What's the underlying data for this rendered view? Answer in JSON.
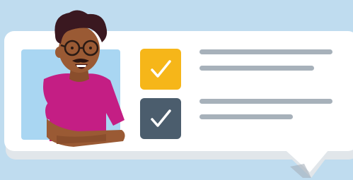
{
  "colors": {
    "background": "#bfdcef",
    "bubble": "#ffffff",
    "bubble_shadow": "#e1e6ea",
    "photo_background": "#a9d6f2",
    "check_done": "#f6b619",
    "check_pending": "#4b5d6d",
    "text_placeholder": "#a7b1ba",
    "shirt": "#c41e84",
    "skin": "#9a5a34",
    "hair": "#3a1820"
  },
  "checklist": {
    "items": [
      {
        "icon": "checkmark-icon",
        "checked": true,
        "variant": "done",
        "line_count": 2
      },
      {
        "icon": "checkmark-icon",
        "checked": true,
        "variant": "pending",
        "line_count": 2
      }
    ]
  },
  "avatar": {
    "icon": "person-with-glasses-icon"
  }
}
